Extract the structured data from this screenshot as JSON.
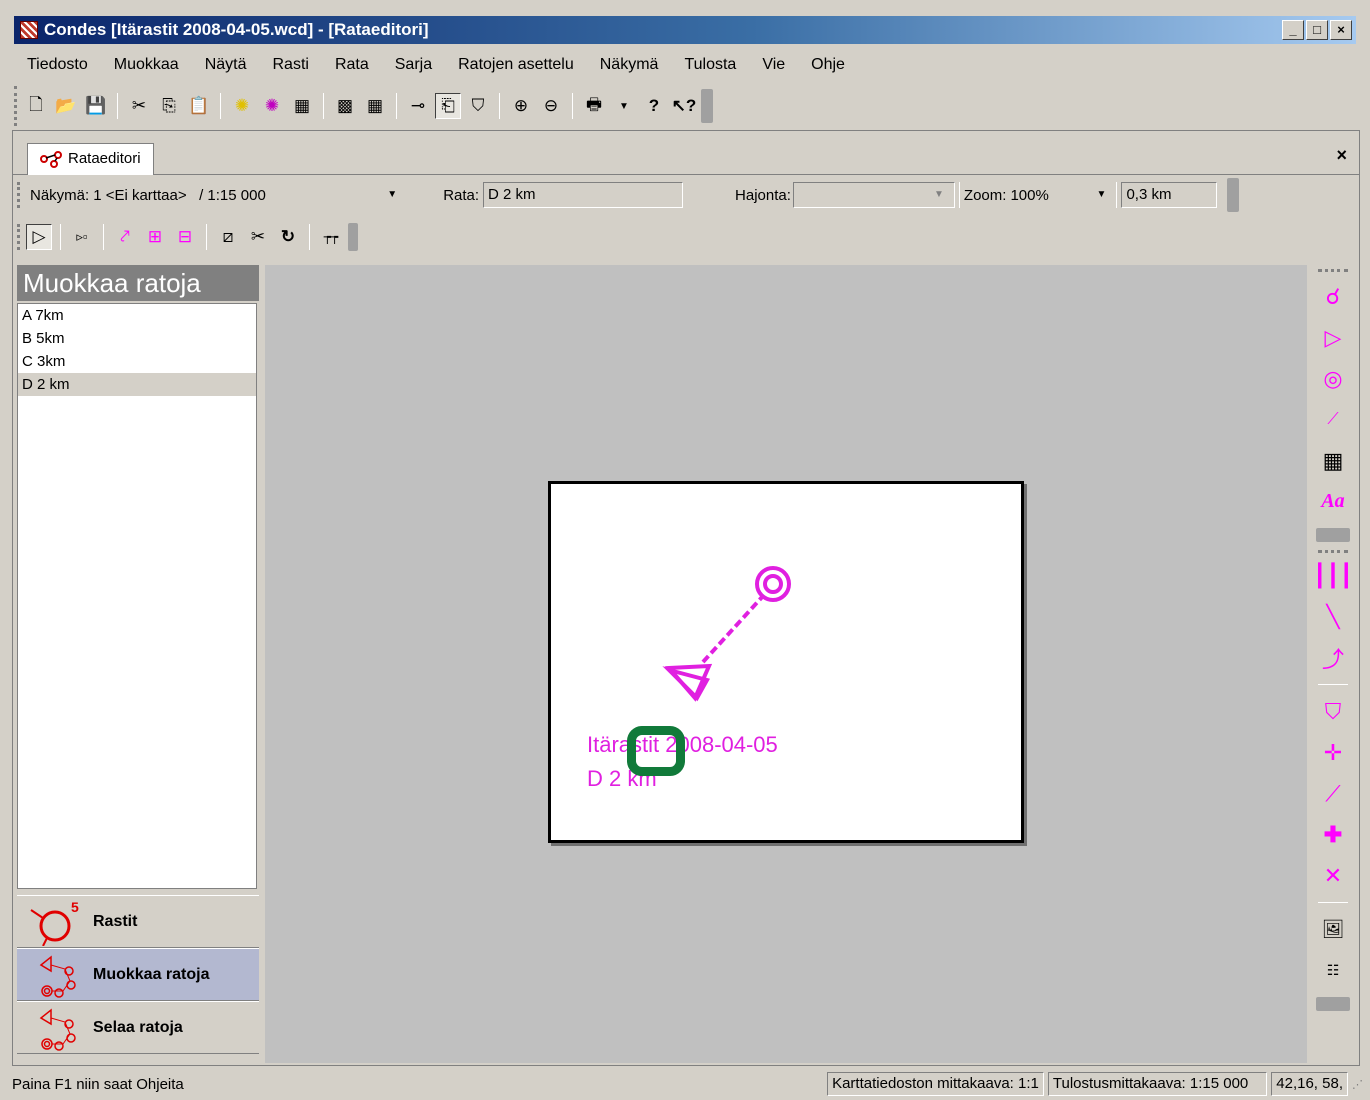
{
  "window": {
    "title": "Condes [Itärastit 2008-04-05.wcd] - [Rataeditori]",
    "controls": [
      "_",
      "□",
      "×"
    ]
  },
  "menu": [
    "Tiedosto",
    "Muokkaa",
    "Näytä",
    "Rasti",
    "Rata",
    "Sarja",
    "Ratojen asettelu",
    "Näkymä",
    "Tulosta",
    "Vie",
    "Ohje"
  ],
  "toolbar_icons": [
    "new-icon",
    "open-icon",
    "save-icon",
    "cut-icon",
    "copy-icon",
    "paste-icon",
    "control-add-icon",
    "control-remove-icon",
    "table-icon",
    "grid-icon",
    "grid-lines-icon",
    "key-icon",
    "page-icon",
    "shield-icon",
    "zoom-in-icon",
    "zoom-out-icon",
    "print-icon",
    "help-icon",
    "context-help-icon"
  ],
  "tab": {
    "label": "Rataeditori",
    "close": "×"
  },
  "viewbar": {
    "view_label": "Näkymä:",
    "view_value": "1 <Ei karttaa>   / 1:15 000",
    "course_label": "Rata:",
    "course_value": "D 2 km",
    "variation_label": "Hajonta:",
    "variation_value": "",
    "zoom_label": "Zoom:",
    "zoom_value": "100%",
    "scale_value": "0,3 km"
  },
  "left_panel": {
    "title": "Muokkaa ratoja",
    "courses": [
      "A 7km",
      "B 5km",
      "C 3km",
      "D 2 km"
    ],
    "selected_index": 3,
    "nav": [
      {
        "label": "Rastit",
        "active": false
      },
      {
        "label": "Muokkaa ratoja",
        "active": true
      },
      {
        "label": "Selaa ratoja",
        "active": false
      }
    ]
  },
  "map": {
    "text_line1": "Itärastit 2008-04-05",
    "text_line2": "D 2 km",
    "course_color": "#e020e0",
    "highlight_color": "#117a3a"
  },
  "status": {
    "help": "Paina F1 niin saat Ohjeita",
    "map_scale": "Karttatiedoston mittakaava: 1:1",
    "print_scale": "Tulostusmittakaava: 1:15 000",
    "coords": "42,16, 58,"
  }
}
